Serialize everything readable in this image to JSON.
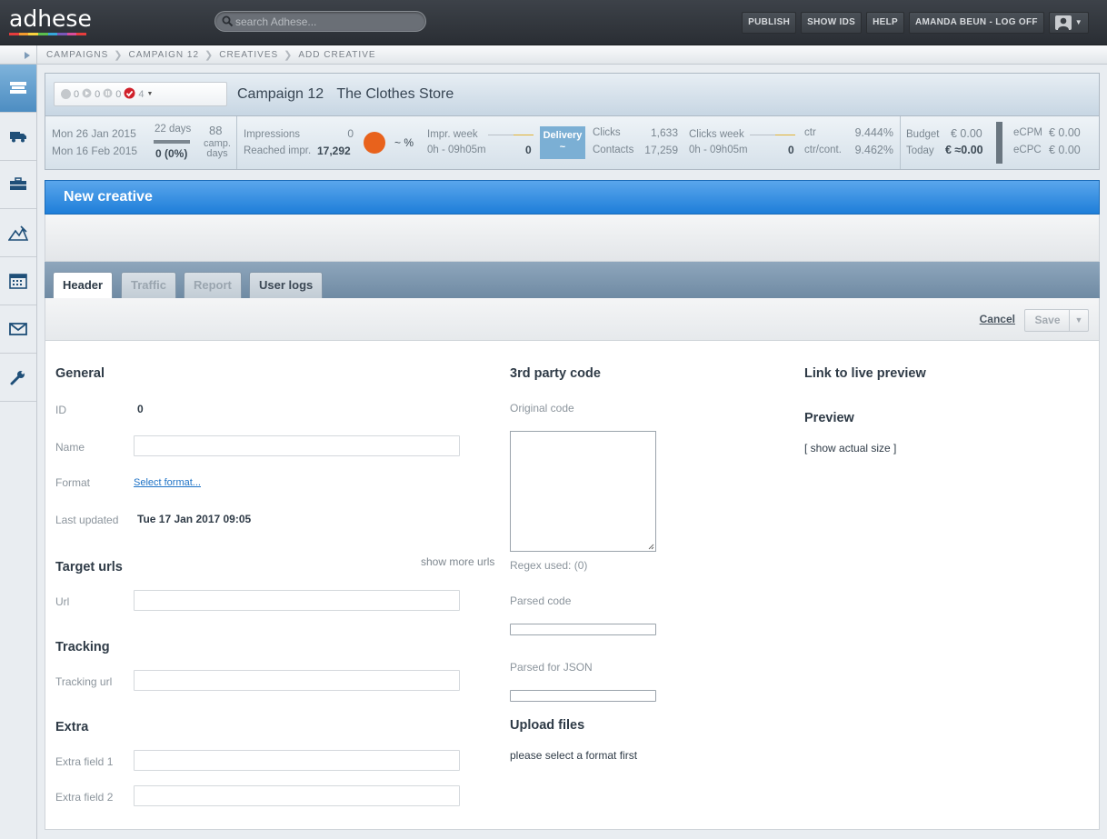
{
  "app": {
    "logo": "adhese",
    "logo_colors": [
      "#e63d3d",
      "#f29a2e",
      "#f7d23e",
      "#5bbf4e",
      "#37a6d9",
      "#7a58b7",
      "#d94d9a",
      "#e63d3d"
    ]
  },
  "search": {
    "placeholder": "search Adhese..."
  },
  "topnav": {
    "publish": "PUBLISH",
    "show_ids": "SHOW IDS",
    "help": "HELP",
    "user": "AMANDA BEUN - LOG OFF"
  },
  "breadcrumb": [
    "CAMPAIGNS",
    "CAMPAIGN 12",
    "CREATIVES",
    "ADD CREATIVE"
  ],
  "sidebar_icons": [
    "campaigns-icon",
    "truck-icon",
    "briefcase-icon",
    "mountain-icon",
    "calendar-icon",
    "envelope-icon",
    "wrench-icon"
  ],
  "campaign": {
    "status": {
      "stopped": "0",
      "running": "0",
      "paused": "0",
      "done": "0",
      "approved": "4"
    },
    "name": "Campaign 12",
    "advertiser": "The Clothes Store",
    "start_date": "Mon 26 Jan 2015",
    "end_date": "Mon 16 Feb 2015",
    "days_label": "22 days",
    "days_progress": "0 (0%)",
    "progress_fraction": 0.0,
    "camp_days_value": "88",
    "camp_days_label": "camp. days",
    "impressions_label": "Impressions",
    "impressions_value": "0",
    "reached_label": "Reached impr.",
    "reached_value": "17,292",
    "pct_label": "~ %",
    "impr_week_label": "Impr. week",
    "impr_week_time": "0h - 09h05m",
    "impr_week_value": "0",
    "delivery_label": "Delivery",
    "delivery_value": "~",
    "clicks_label": "Clicks",
    "clicks_value": "1,633",
    "contacts_label": "Contacts",
    "contacts_value": "17,259",
    "clicks_week_label": "Clicks week",
    "clicks_week_time": "0h - 09h05m",
    "clicks_week_value": "0",
    "ctr_label": "ctr",
    "ctr_value": "9.444%",
    "ctr_cont_label": "ctr/cont.",
    "ctr_cont_value": "9.462%",
    "budget_label": "Budget",
    "budget_value": "€ 0.00",
    "today_label": "Today",
    "today_value": "€ ≈0.00",
    "ecpm_label": "eCPM",
    "ecpm_value": "€ 0.00",
    "ecpc_label": "eCPC",
    "ecpc_value": "€ 0.00",
    "status_color": "#e8621c",
    "delivery_color": "#7bafd4"
  },
  "panel": {
    "title": "New creative"
  },
  "tabs": [
    "Header",
    "Traffic",
    "Report",
    "User logs"
  ],
  "actions": {
    "cancel": "Cancel",
    "save": "Save"
  },
  "general": {
    "title": "General",
    "id_label": "ID",
    "id_value": "0",
    "name_label": "Name",
    "name_value": "",
    "format_label": "Format",
    "format_link": "Select format...",
    "updated_label": "Last updated",
    "updated_value": "Tue 17 Jan 2017 09:05"
  },
  "target": {
    "title": "Target urls",
    "more": "show more urls",
    "url_label": "Url",
    "url_value": ""
  },
  "tracking": {
    "title": "Tracking",
    "url_label": "Tracking url",
    "url_value": ""
  },
  "extra": {
    "title": "Extra",
    "field1_label": "Extra field 1",
    "field2_label": "Extra field 2"
  },
  "third_party": {
    "title": "3rd party code",
    "original_label": "Original code",
    "regex_label": "Regex used: (0)",
    "parsed_label": "Parsed code",
    "parsed_json_label": "Parsed for JSON"
  },
  "upload": {
    "title": "Upload files",
    "note": "please select a format first"
  },
  "preview": {
    "live_title": "Link to live preview",
    "title": "Preview",
    "actual_size": "[ show actual size ]"
  }
}
